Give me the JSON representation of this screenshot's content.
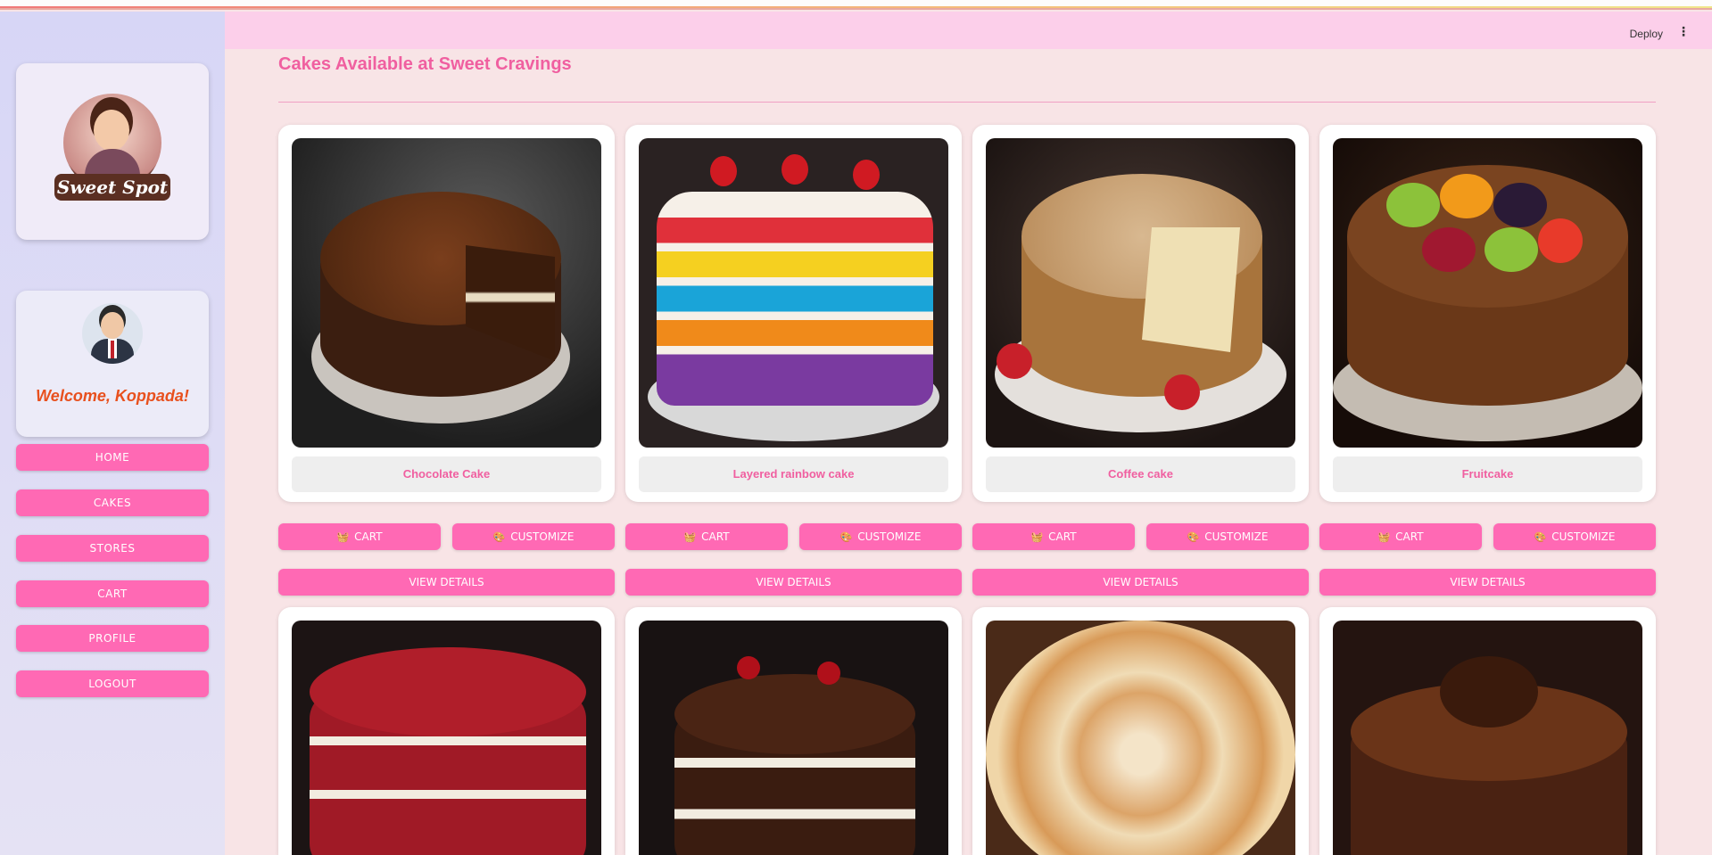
{
  "app": {
    "logo_text": "Sweet Spot",
    "deploy_label": "Deploy",
    "menu_icon": "vertical-dots-icon"
  },
  "sidebar": {
    "welcome": "Welcome, Koppada!",
    "nav": [
      {
        "label": "HOME"
      },
      {
        "label": "CAKES"
      },
      {
        "label": "STORES"
      },
      {
        "label": "CART"
      },
      {
        "label": "PROFILE"
      },
      {
        "label": "LOGOUT"
      }
    ]
  },
  "main": {
    "title": "Cakes Available at Sweet Cravings",
    "cakes": [
      {
        "name": "Chocolate Cake"
      },
      {
        "name": "Layered rainbow cake"
      },
      {
        "name": "Coffee cake"
      },
      {
        "name": "Fruitcake"
      }
    ],
    "cart_label": "CART",
    "customize_label": "CUSTOMIZE",
    "view_details_label": "VIEW DETAILS",
    "cart_icon": "basket-icon",
    "customize_icon": "palette-icon"
  },
  "colors": {
    "accent": "#ff69b4",
    "title": "#f05fa0",
    "sidebar_bg": "#d7d6f6",
    "page_bg": "#f8e4e6",
    "header_bg": "#fccfea",
    "welcome": "#e8501e"
  }
}
